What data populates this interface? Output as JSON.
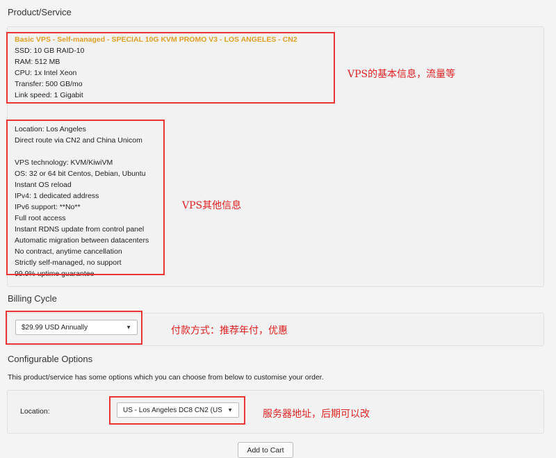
{
  "product_section": {
    "title": "Product/Service",
    "basic": {
      "name": "Basic VPS - Self-managed - SPECIAL 10G KVM PROMO V3 - LOS ANGELES - CN2",
      "lines": [
        "SSD: 10 GB RAID-10",
        "RAM: 512 MB",
        "CPU: 1x Intel Xeon",
        "Transfer: 500 GB/mo",
        "Link speed: 1 Gigabit"
      ]
    },
    "other_lines": [
      "Location: Los Angeles",
      "Direct route via CN2 and China Unicom",
      "",
      "VPS technology: KVM/KiwiVM",
      "OS: 32 or 64 bit Centos, Debian, Ubuntu",
      "Instant OS reload",
      "IPv4: 1 dedicated address",
      "IPv6 support: **No**",
      "Full root access",
      "Instant RDNS update from control panel",
      "Automatic migration between datacenters",
      "No contract, anytime cancellation",
      "Strictly self-managed, no support",
      "99.9% uptime guarantee"
    ]
  },
  "billing": {
    "title": "Billing Cycle",
    "selected": "$29.99 USD Annually"
  },
  "config": {
    "title": "Configurable Options",
    "description": "This product/service has some options which you can choose from below to customise your order.",
    "location_label": "Location:",
    "location_selected": "US - Los Angeles DC8 CN2 (US"
  },
  "add_to_cart_label": "Add to Cart",
  "annotations": {
    "basic_info": "VPS的基本信息，流量等",
    "other_info": "VPS其他信息",
    "billing": "付款方式：推荐年付，优惠",
    "location": "服务器地址，后期可以改"
  },
  "colors": {
    "annotation_red": "#e33333",
    "product_name_orange": "#e0a023"
  },
  "icons": {
    "select_caret": "▼"
  }
}
